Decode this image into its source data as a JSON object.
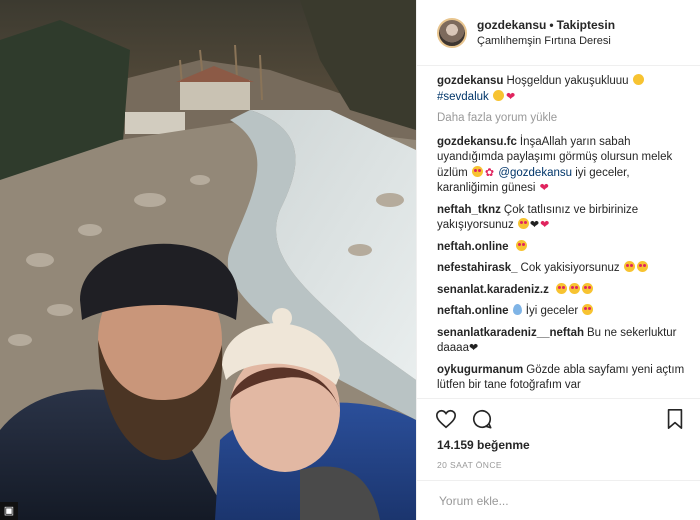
{
  "post": {
    "username": "gozdekansu",
    "follow_label": "Takiptesin",
    "location": "Çamlıhemşin Fırtına Deresi"
  },
  "caption": {
    "username": "gozdekansu",
    "text": "Hoşgeldun yakuşukluuu",
    "hashtag": "#sevdaluk"
  },
  "load_more_label": "Daha fazla yorum yükle",
  "comments": [
    {
      "username": "gozdekansu.fc",
      "text": "İnşaAllah yarın sabah uyandığımda paylaşımı görmüş olursun melek üzlüm",
      "mention": "@gozdekansu",
      "text2": "iyi geceler, karanliğimin günesi"
    },
    {
      "username": "neftah_tknz",
      "text": "Çok tatlısınız ve birbirinize yakışıyorsunuz"
    },
    {
      "username": "neftah.online",
      "text": ""
    },
    {
      "username": "nefestahirask_",
      "text": "Cok yakisiyorsunuz"
    },
    {
      "username": "senanlat.karadeniz.z",
      "text": ""
    },
    {
      "username": "neftah.online",
      "text": "İyi geceler"
    },
    {
      "username": "senanlatkaradeniz__neftah",
      "text": "Bu ne sekerluktur daaaa"
    },
    {
      "username": "oykugurmanum",
      "text": "Gözde abla sayfamı yeni açtım lütfen bir tane fotoğrafım var"
    }
  ],
  "likes_label": "14.159 beğenme",
  "timestamp": "20 SAAT ÖNCE",
  "comment_input": {
    "placeholder": "Yorum ekle..."
  },
  "icons": [
    "heart-icon",
    "comment-icon",
    "bookmark-icon",
    "instagram-icon"
  ]
}
